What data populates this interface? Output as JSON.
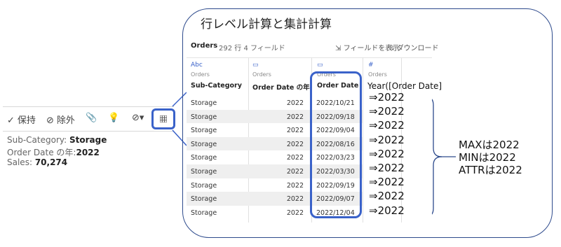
{
  "callout": {
    "title": "行レベル計算と集計計算"
  },
  "tooltip": {
    "toolbar": {
      "keep": "保持",
      "exclude": "除外"
    },
    "lines": [
      {
        "label": "Sub-Category:",
        "value": "Storage"
      },
      {
        "label": "Order Date の年:",
        "value": "2022"
      },
      {
        "label": "Sales:",
        "value": "70,274"
      }
    ]
  },
  "data_panel": {
    "source": "Orders",
    "summary": "292 行 4 フィールド",
    "show_fields": "フィールドを表示",
    "download": "ダウンロード",
    "columns": [
      {
        "type_icon": "Abc",
        "source": "Orders",
        "name": "Sub-Category"
      },
      {
        "type_icon": "calendar",
        "source": "Orders",
        "name": "Order Date の年"
      },
      {
        "type_icon": "calendar",
        "source": "Orders",
        "name": "Order Date"
      },
      {
        "type_icon": "#",
        "source": "Orders",
        "name": ""
      }
    ],
    "rows": [
      {
        "sub_category": "Storage",
        "year": "2022",
        "date": "2022/10/21"
      },
      {
        "sub_category": "Storage",
        "year": "2022",
        "date": "2022/09/18"
      },
      {
        "sub_category": "Storage",
        "year": "2022",
        "date": "2022/09/04"
      },
      {
        "sub_category": "Storage",
        "year": "2022",
        "date": "2022/08/16"
      },
      {
        "sub_category": "Storage",
        "year": "2022",
        "date": "2022/03/23"
      },
      {
        "sub_category": "Storage",
        "year": "2022",
        "date": "2022/03/30"
      },
      {
        "sub_category": "Storage",
        "year": "2022",
        "date": "2022/09/19"
      },
      {
        "sub_category": "Storage",
        "year": "2022",
        "date": "2022/09/07"
      },
      {
        "sub_category": "Storage",
        "year": "2022",
        "date": "2022/12/04"
      }
    ]
  },
  "annotation": {
    "header": "Year([Order Date]",
    "results": [
      "⇒2022",
      "⇒2022",
      "⇒2022",
      "⇒2022",
      "⇒2022",
      "⇒2022",
      "⇒2022",
      "⇒2022",
      "⇒2022"
    ],
    "summary": [
      "MAXは2022",
      "MINは2022",
      "ATTRは2022"
    ]
  },
  "colors": {
    "accent": "#3a62c9",
    "callout_border": "#2d4a8c",
    "row_alt": "#efefef"
  }
}
